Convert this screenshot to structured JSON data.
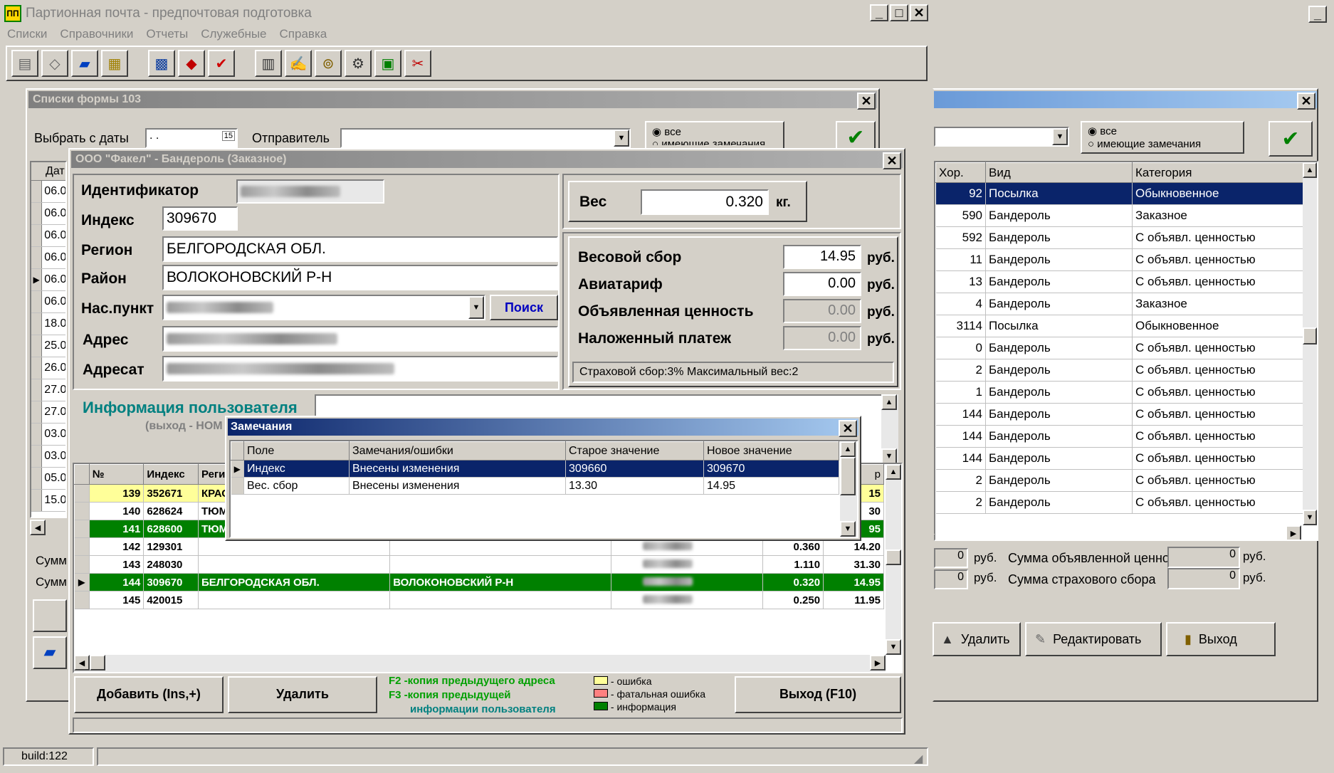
{
  "app": {
    "title": "Партионная почта - предпочтовая подготовка",
    "menu": [
      "Списки",
      "Справочники",
      "Отчеты",
      "Служебные",
      "Справка"
    ],
    "build": "build:122",
    "toolbar_icons": [
      "stamps-icon",
      "tag-icon",
      "floppy-icon",
      "clipboard-icon",
      "filter-icon",
      "book-icon",
      "checkmark-icon",
      "calculator-icon",
      "sign-icon",
      "binoculars-icon",
      "gear-icon",
      "monitor-icon",
      "scissors-icon"
    ]
  },
  "lists103": {
    "title": "Списки формы 103",
    "date_label": "Выбрать с даты",
    "date_value": " . .",
    "sender_label": "Отправитель",
    "radio_all": "все",
    "radio_remarks": "имеющие замечания",
    "left_rows": [
      "06.0",
      "06.0",
      "06.0",
      "06.0",
      "06.0",
      "06.0",
      "18.0",
      "25.0",
      "26.0",
      "27.0",
      "27.0",
      "03.0",
      "03.0",
      "05.0",
      "15.0"
    ],
    "left_header": "Дат",
    "summ_label": "Сумм"
  },
  "right_panel": {
    "columns": [
      "Хор.",
      "Вид",
      "Категория"
    ],
    "rows": [
      [
        "92",
        "Посылка",
        "Обыкновенное"
      ],
      [
        "590",
        "Бандероль",
        "Заказное"
      ],
      [
        "592",
        "Бандероль",
        "С объявл. ценностью"
      ],
      [
        "11",
        "Бандероль",
        "С объявл. ценностью"
      ],
      [
        "13",
        "Бандероль",
        "С объявл. ценностью"
      ],
      [
        "4",
        "Бандероль",
        "Заказное"
      ],
      [
        "3114",
        "Посылка",
        "Обыкновенное"
      ],
      [
        "0",
        "Бандероль",
        "С объявл. ценностью"
      ],
      [
        "2",
        "Бандероль",
        "С объявл. ценностью"
      ],
      [
        "1",
        "Бандероль",
        "С объявл. ценностью"
      ],
      [
        "144",
        "Бандероль",
        "С объявл. ценностью"
      ],
      [
        "144",
        "Бандероль",
        "С объявл. ценностью"
      ],
      [
        "144",
        "Бандероль",
        "С объявл. ценностью"
      ],
      [
        "2",
        "Бандероль",
        "С объявл. ценностью"
      ],
      [
        "2",
        "Бандероль",
        "С объявл. ценностью"
      ]
    ],
    "sum1_value": "0",
    "sum1_unit": "руб.",
    "sum1_label": "Сумма объявленной ценности",
    "sum1_right": "0",
    "sum1_right_unit": "руб.",
    "sum2_value": "0",
    "sum2_unit": "руб.",
    "sum2_label": "Сумма страхового сбора",
    "sum2_right": "0",
    "sum2_right_unit": "руб.",
    "btn_delete": "Удалить",
    "btn_edit": "Редактировать",
    "btn_exit": "Выход"
  },
  "parcel": {
    "title": "ООО \"Факел\" - Бандероль (Заказное)",
    "id_label": "Идентификатор",
    "index_label": "Индекс",
    "index_value": "309670",
    "region_label": "Регион",
    "region_value": "БЕЛГОРОДСКАЯ ОБЛ.",
    "district_label": "Район",
    "district_value": "ВОЛОКОНОВСКИЙ Р-Н",
    "locality_label": "Нас.пункт",
    "search_btn": "Поиск",
    "address_label": "Адрес",
    "addressee_label": "Адресат",
    "weight_label": "Вес",
    "weight_value": "0.320",
    "weight_unit": "кг.",
    "fee_label": "Весовой сбор",
    "fee_value": "14.95",
    "avia_label": "Авиатариф",
    "avia_value": "0.00",
    "declared_label": "Объявленная ценность",
    "declared_value": "0.00",
    "cod_label": "Наложенный платеж",
    "cod_value": "0.00",
    "rub": "руб.",
    "insurance_note": "Страховой сбор:3% Максимальный вес:2",
    "userinfo_label": "Информация пользователя",
    "userinfo_hint": "(выход - НОМ",
    "grid_headers": [
      "№",
      "Индекс",
      "Регион"
    ],
    "grid_rows": [
      {
        "n": "139",
        "idx": "352671",
        "reg": "КРАС",
        "dist": "",
        "w": "",
        "f": "15",
        "style": "yellow"
      },
      {
        "n": "140",
        "idx": "628624",
        "reg": "ТЮМ",
        "dist": "",
        "w": "",
        "f": "30",
        "style": "white"
      },
      {
        "n": "141",
        "idx": "628600",
        "reg": "ТЮМ",
        "dist": "",
        "w": "",
        "f": "95",
        "style": "green"
      },
      {
        "n": "142",
        "idx": "129301",
        "reg": "",
        "dist": "",
        "w": "0.360",
        "f": "14.20",
        "style": "white"
      },
      {
        "n": "143",
        "idx": "248030",
        "reg": "",
        "dist": "",
        "w": "1.110",
        "f": "31.30",
        "style": "white"
      },
      {
        "n": "144",
        "idx": "309670",
        "reg": "БЕЛГОРОДСКАЯ ОБЛ.",
        "dist": "ВОЛОКОНОВСКИЙ Р-Н",
        "w": "0.320",
        "f": "14.95",
        "style": "green"
      },
      {
        "n": "145",
        "idx": "420015",
        "reg": "",
        "dist": "",
        "w": "0.250",
        "f": "11.95",
        "style": "white"
      }
    ],
    "btn_add": "Добавить (Ins,+)",
    "btn_delete": "Удалить",
    "btn_exit": "Выход (F10)",
    "hint_f2": "F2 -копия предыдущего адреса",
    "hint_f3": "F3 -копия предыдущей",
    "hint_f3b": "информации пользователя",
    "legend_error": "- ошибка",
    "legend_fatal": "- фатальная ошибка",
    "legend_info": "- информация",
    "col_label_p": "р"
  },
  "remarks": {
    "title": "Замечания",
    "columns": [
      "Поле",
      "Замечания/ошибки",
      "Старое значение",
      "Новое значение"
    ],
    "rows": [
      [
        "Индекс",
        "Внесены изменения",
        "309660",
        "309670"
      ],
      [
        "Вес. сбор",
        "Внесены изменения",
        "13.30",
        "14.95"
      ]
    ]
  },
  "colors": {
    "selection": "#0a246a",
    "green_row": "#008000",
    "yellow_row": "#ffff99",
    "teal_text": "#008080"
  }
}
